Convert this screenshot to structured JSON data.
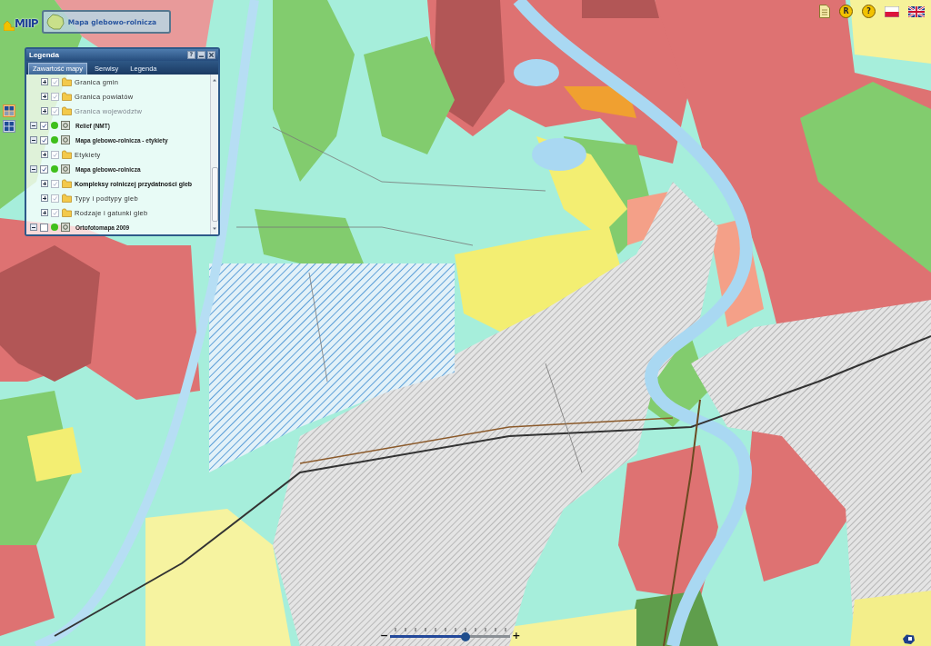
{
  "header": {
    "logo_text": "MIIP",
    "title": "Mapa glebowo-rolnicza"
  },
  "toolbar": [
    {
      "kind": "document"
    },
    {
      "kind": "letter",
      "label": "R"
    },
    {
      "kind": "letter",
      "label": "?"
    },
    {
      "kind": "flag_pl"
    },
    {
      "kind": "flag_uk"
    }
  ],
  "map_switch": [
    {
      "selected": true
    },
    {
      "selected": false
    }
  ],
  "legend": {
    "title": "Legenda",
    "help_label": "?",
    "tabs": [
      {
        "label": "Zawartość mapy",
        "selected": true
      },
      {
        "label": "Serwisy",
        "selected": false
      },
      {
        "label": "Legenda",
        "selected": false
      }
    ],
    "layers": [
      {
        "children": [
          {
            "label": "Granica gmin",
            "expanded": false,
            "checked": true,
            "disabled": false,
            "selected": false
          },
          {
            "label": "Granica powiatów",
            "expanded": false,
            "checked": true,
            "disabled": false,
            "selected": false
          },
          {
            "label": "Granica województw",
            "expanded": false,
            "checked": true,
            "disabled": true,
            "selected": false
          }
        ]
      },
      {
        "label": "Relief (NMT)",
        "expanded": true,
        "checked": true
      },
      {
        "label": "Mapa glebowo-rolnicza - etykiety",
        "expanded": true,
        "checked": true,
        "children": [
          {
            "label": "Etykiety",
            "expanded": false,
            "checked": true,
            "disabled": false,
            "selected": false
          }
        ]
      },
      {
        "label": "Mapa glebowo-rolnicza",
        "expanded": true,
        "checked": true,
        "children": [
          {
            "label": "Kompleksy rolniczej przydatności gleb",
            "expanded": false,
            "checked": true,
            "disabled": false,
            "selected": true
          },
          {
            "label": "Typy i podtypy gleb",
            "expanded": false,
            "checked": true,
            "disabled": false,
            "selected": false
          },
          {
            "label": "Rodzaje i gatunki gleb",
            "expanded": false,
            "checked": true,
            "disabled": false,
            "selected": false
          }
        ]
      },
      {
        "label": "Ortofotomapa 2009",
        "expanded": true,
        "checked": false
      }
    ]
  },
  "zoom": {
    "minus": "−",
    "plus": "+",
    "level": 0.63
  }
}
